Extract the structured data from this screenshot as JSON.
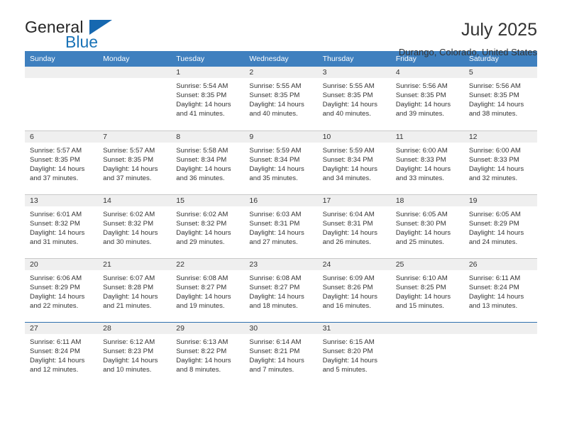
{
  "brand": {
    "name_top": "General",
    "name_bottom": "Blue",
    "accent_color": "#1668b0",
    "text_color": "#262626"
  },
  "header": {
    "title": "July 2025",
    "subtitle": "Durango, Colorado, United States"
  },
  "theme": {
    "header_row_bg": "#3f80bf",
    "day_band_bg": "#efefef",
    "grid_line": "#c9c9c9",
    "last_row_line": "#2f6fae",
    "text": "#333333"
  },
  "weekday_headers": [
    "Sunday",
    "Monday",
    "Tuesday",
    "Wednesday",
    "Thursday",
    "Friday",
    "Saturday"
  ],
  "weeks": [
    [
      {
        "day": "",
        "empty": true
      },
      {
        "day": "",
        "empty": true
      },
      {
        "day": "1",
        "sunrise": "Sunrise: 5:54 AM",
        "sunset": "Sunset: 8:35 PM",
        "daylight": "Daylight: 14 hours and 41 minutes."
      },
      {
        "day": "2",
        "sunrise": "Sunrise: 5:55 AM",
        "sunset": "Sunset: 8:35 PM",
        "daylight": "Daylight: 14 hours and 40 minutes."
      },
      {
        "day": "3",
        "sunrise": "Sunrise: 5:55 AM",
        "sunset": "Sunset: 8:35 PM",
        "daylight": "Daylight: 14 hours and 40 minutes."
      },
      {
        "day": "4",
        "sunrise": "Sunrise: 5:56 AM",
        "sunset": "Sunset: 8:35 PM",
        "daylight": "Daylight: 14 hours and 39 minutes."
      },
      {
        "day": "5",
        "sunrise": "Sunrise: 5:56 AM",
        "sunset": "Sunset: 8:35 PM",
        "daylight": "Daylight: 14 hours and 38 minutes."
      }
    ],
    [
      {
        "day": "6",
        "sunrise": "Sunrise: 5:57 AM",
        "sunset": "Sunset: 8:35 PM",
        "daylight": "Daylight: 14 hours and 37 minutes."
      },
      {
        "day": "7",
        "sunrise": "Sunrise: 5:57 AM",
        "sunset": "Sunset: 8:35 PM",
        "daylight": "Daylight: 14 hours and 37 minutes."
      },
      {
        "day": "8",
        "sunrise": "Sunrise: 5:58 AM",
        "sunset": "Sunset: 8:34 PM",
        "daylight": "Daylight: 14 hours and 36 minutes."
      },
      {
        "day": "9",
        "sunrise": "Sunrise: 5:59 AM",
        "sunset": "Sunset: 8:34 PM",
        "daylight": "Daylight: 14 hours and 35 minutes."
      },
      {
        "day": "10",
        "sunrise": "Sunrise: 5:59 AM",
        "sunset": "Sunset: 8:34 PM",
        "daylight": "Daylight: 14 hours and 34 minutes."
      },
      {
        "day": "11",
        "sunrise": "Sunrise: 6:00 AM",
        "sunset": "Sunset: 8:33 PM",
        "daylight": "Daylight: 14 hours and 33 minutes."
      },
      {
        "day": "12",
        "sunrise": "Sunrise: 6:00 AM",
        "sunset": "Sunset: 8:33 PM",
        "daylight": "Daylight: 14 hours and 32 minutes."
      }
    ],
    [
      {
        "day": "13",
        "sunrise": "Sunrise: 6:01 AM",
        "sunset": "Sunset: 8:32 PM",
        "daylight": "Daylight: 14 hours and 31 minutes."
      },
      {
        "day": "14",
        "sunrise": "Sunrise: 6:02 AM",
        "sunset": "Sunset: 8:32 PM",
        "daylight": "Daylight: 14 hours and 30 minutes."
      },
      {
        "day": "15",
        "sunrise": "Sunrise: 6:02 AM",
        "sunset": "Sunset: 8:32 PM",
        "daylight": "Daylight: 14 hours and 29 minutes."
      },
      {
        "day": "16",
        "sunrise": "Sunrise: 6:03 AM",
        "sunset": "Sunset: 8:31 PM",
        "daylight": "Daylight: 14 hours and 27 minutes."
      },
      {
        "day": "17",
        "sunrise": "Sunrise: 6:04 AM",
        "sunset": "Sunset: 8:31 PM",
        "daylight": "Daylight: 14 hours and 26 minutes."
      },
      {
        "day": "18",
        "sunrise": "Sunrise: 6:05 AM",
        "sunset": "Sunset: 8:30 PM",
        "daylight": "Daylight: 14 hours and 25 minutes."
      },
      {
        "day": "19",
        "sunrise": "Sunrise: 6:05 AM",
        "sunset": "Sunset: 8:29 PM",
        "daylight": "Daylight: 14 hours and 24 minutes."
      }
    ],
    [
      {
        "day": "20",
        "sunrise": "Sunrise: 6:06 AM",
        "sunset": "Sunset: 8:29 PM",
        "daylight": "Daylight: 14 hours and 22 minutes."
      },
      {
        "day": "21",
        "sunrise": "Sunrise: 6:07 AM",
        "sunset": "Sunset: 8:28 PM",
        "daylight": "Daylight: 14 hours and 21 minutes."
      },
      {
        "day": "22",
        "sunrise": "Sunrise: 6:08 AM",
        "sunset": "Sunset: 8:27 PM",
        "daylight": "Daylight: 14 hours and 19 minutes."
      },
      {
        "day": "23",
        "sunrise": "Sunrise: 6:08 AM",
        "sunset": "Sunset: 8:27 PM",
        "daylight": "Daylight: 14 hours and 18 minutes."
      },
      {
        "day": "24",
        "sunrise": "Sunrise: 6:09 AM",
        "sunset": "Sunset: 8:26 PM",
        "daylight": "Daylight: 14 hours and 16 minutes."
      },
      {
        "day": "25",
        "sunrise": "Sunrise: 6:10 AM",
        "sunset": "Sunset: 8:25 PM",
        "daylight": "Daylight: 14 hours and 15 minutes."
      },
      {
        "day": "26",
        "sunrise": "Sunrise: 6:11 AM",
        "sunset": "Sunset: 8:24 PM",
        "daylight": "Daylight: 14 hours and 13 minutes."
      }
    ],
    [
      {
        "day": "27",
        "sunrise": "Sunrise: 6:11 AM",
        "sunset": "Sunset: 8:24 PM",
        "daylight": "Daylight: 14 hours and 12 minutes."
      },
      {
        "day": "28",
        "sunrise": "Sunrise: 6:12 AM",
        "sunset": "Sunset: 8:23 PM",
        "daylight": "Daylight: 14 hours and 10 minutes."
      },
      {
        "day": "29",
        "sunrise": "Sunrise: 6:13 AM",
        "sunset": "Sunset: 8:22 PM",
        "daylight": "Daylight: 14 hours and 8 minutes."
      },
      {
        "day": "30",
        "sunrise": "Sunrise: 6:14 AM",
        "sunset": "Sunset: 8:21 PM",
        "daylight": "Daylight: 14 hours and 7 minutes."
      },
      {
        "day": "31",
        "sunrise": "Sunrise: 6:15 AM",
        "sunset": "Sunset: 8:20 PM",
        "daylight": "Daylight: 14 hours and 5 minutes."
      },
      {
        "day": "",
        "empty": true
      },
      {
        "day": "",
        "empty": true
      }
    ]
  ]
}
